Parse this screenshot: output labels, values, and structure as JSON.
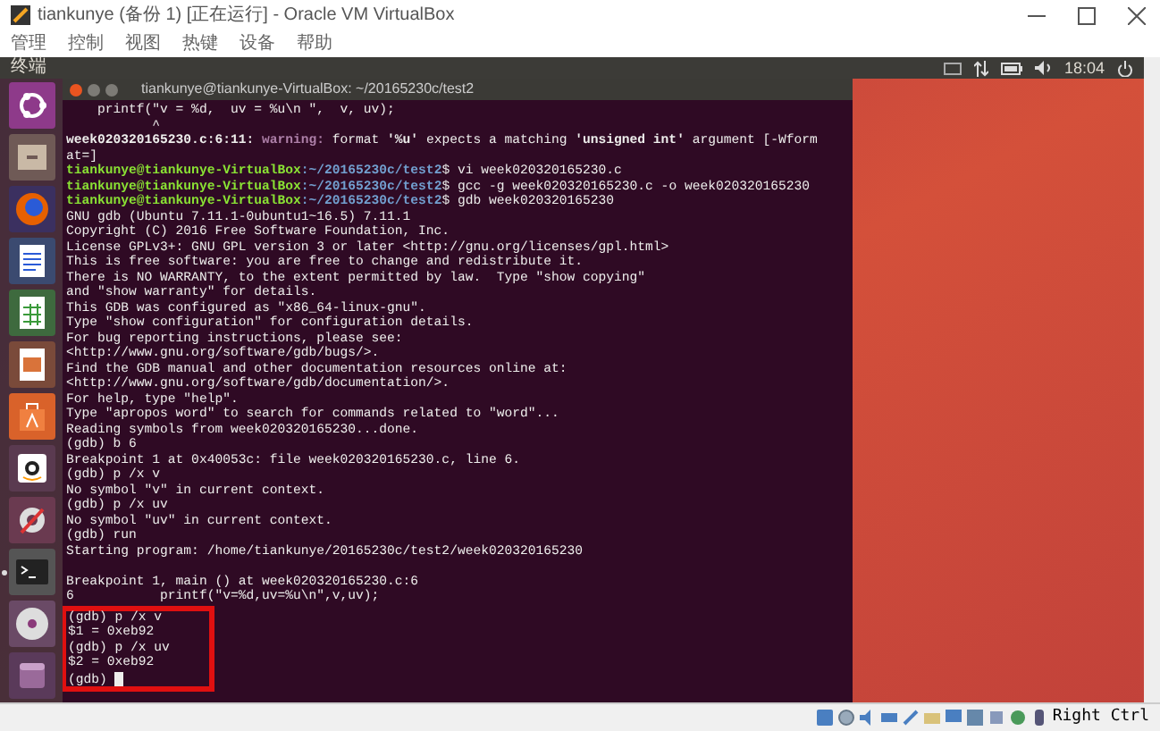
{
  "window": {
    "title": "tiankunye (备份 1) [正在运行] - Oracle VM VirtualBox"
  },
  "menu": [
    "管理",
    "控制",
    "视图",
    "热键",
    "设备",
    "帮助"
  ],
  "top_panel": {
    "app_name": "终端",
    "clock": "18:04"
  },
  "launcher": [
    {
      "kind": "ubuntu",
      "running": false
    },
    {
      "kind": "files",
      "running": false
    },
    {
      "kind": "browser",
      "running": false
    },
    {
      "kind": "writer",
      "running": false
    },
    {
      "kind": "calc",
      "running": false
    },
    {
      "kind": "impress",
      "running": false
    },
    {
      "kind": "software",
      "running": false
    },
    {
      "kind": "amazon",
      "running": false
    },
    {
      "kind": "settings",
      "running": false
    },
    {
      "kind": "terminal",
      "running": true
    },
    {
      "kind": "disc",
      "running": false
    },
    {
      "kind": "drive",
      "running": false
    }
  ],
  "terminal": {
    "title": "tiankunye@tiankunye-VirtualBox: ~/20165230c/test2",
    "lines": [
      {
        "kind": "output",
        "text": "    printf(\"v = %d,  uv = %u\\n \",  v, uv);",
        "highlighted": false
      },
      {
        "kind": "output",
        "text": "           ^",
        "highlighted": false
      },
      {
        "kind": "warning",
        "location": "week020320165230.c:6:11:",
        "label": "warning:",
        "text": " format **'%u'** expects a matching **'unsigned int'** argument [-Wform",
        "highlighted": false
      },
      {
        "kind": "output",
        "text": "at=]",
        "highlighted": false
      },
      {
        "kind": "prompt",
        "user": "tiankunye@tiankunye-VirtualBox",
        "path": ":~/20165230c/test2",
        "command": "$ vi week020320165230.c",
        "highlighted": false
      },
      {
        "kind": "prompt",
        "user": "tiankunye@tiankunye-VirtualBox",
        "path": ":~/20165230c/test2",
        "command": "$ gcc -g week020320165230.c -o week020320165230",
        "highlighted": false
      },
      {
        "kind": "prompt",
        "user": "tiankunye@tiankunye-VirtualBox",
        "path": ":~/20165230c/test2",
        "command": "$ gdb week020320165230",
        "highlighted": false
      },
      {
        "kind": "output",
        "text": "GNU gdb (Ubuntu 7.11.1-0ubuntu1~16.5) 7.11.1",
        "highlighted": false
      },
      {
        "kind": "output",
        "text": "Copyright (C) 2016 Free Software Foundation, Inc.",
        "highlighted": false
      },
      {
        "kind": "output",
        "text": "License GPLv3+: GNU GPL version 3 or later <http://gnu.org/licenses/gpl.html>",
        "highlighted": false
      },
      {
        "kind": "output",
        "text": "This is free software: you are free to change and redistribute it.",
        "highlighted": false
      },
      {
        "kind": "output",
        "text": "There is NO WARRANTY, to the extent permitted by law.  Type \"show copying\"",
        "highlighted": false
      },
      {
        "kind": "output",
        "text": "and \"show warranty\" for details.",
        "highlighted": false
      },
      {
        "kind": "output",
        "text": "This GDB was configured as \"x86_64-linux-gnu\".",
        "highlighted": false
      },
      {
        "kind": "output",
        "text": "Type \"show configuration\" for configuration details.",
        "highlighted": false
      },
      {
        "kind": "output",
        "text": "For bug reporting instructions, please see:",
        "highlighted": false
      },
      {
        "kind": "output",
        "text": "<http://www.gnu.org/software/gdb/bugs/>.",
        "highlighted": false
      },
      {
        "kind": "output",
        "text": "Find the GDB manual and other documentation resources online at:",
        "highlighted": false
      },
      {
        "kind": "output",
        "text": "<http://www.gnu.org/software/gdb/documentation/>.",
        "highlighted": false
      },
      {
        "kind": "output",
        "text": "For help, type \"help\".",
        "highlighted": false
      },
      {
        "kind": "output",
        "text": "Type \"apropos word\" to search for commands related to \"word\"...",
        "highlighted": false
      },
      {
        "kind": "output",
        "text": "Reading symbols from week020320165230...done.",
        "highlighted": false
      },
      {
        "kind": "output",
        "text": "(gdb) b 6",
        "highlighted": false
      },
      {
        "kind": "output",
        "text": "Breakpoint 1 at 0x40053c: file week020320165230.c, line 6.",
        "highlighted": false
      },
      {
        "kind": "output",
        "text": "(gdb) p /x v",
        "highlighted": false
      },
      {
        "kind": "output",
        "text": "No symbol \"v\" in current context.",
        "highlighted": false
      },
      {
        "kind": "output",
        "text": "(gdb) p /x uv",
        "highlighted": false
      },
      {
        "kind": "output",
        "text": "No symbol \"uv\" in current context.",
        "highlighted": false
      },
      {
        "kind": "output",
        "text": "(gdb) run",
        "highlighted": false
      },
      {
        "kind": "output",
        "text": "Starting program: /home/tiankunye/20165230c/test2/week020320165230",
        "highlighted": false
      },
      {
        "kind": "output",
        "text": "Breakpoint 1, main () at week020320165230.c:6",
        "highlighted": false,
        "gap_before": true
      },
      {
        "kind": "output",
        "text": "6\t    printf(\"v=%d,uv=%u\\n\",v,uv);",
        "highlighted": false
      },
      {
        "kind": "output",
        "text": "(gdb) p /x v",
        "highlighted": true
      },
      {
        "kind": "output",
        "text": "$1 = 0xeb92",
        "highlighted": true
      },
      {
        "kind": "output",
        "text": "(gdb) p /x uv",
        "highlighted": true
      },
      {
        "kind": "output",
        "text": "$2 = 0xeb92",
        "highlighted": true
      },
      {
        "kind": "input",
        "text": "(gdb) ",
        "cursor": true,
        "highlighted": true
      }
    ]
  },
  "status_bar": {
    "host_key": "Right Ctrl"
  }
}
